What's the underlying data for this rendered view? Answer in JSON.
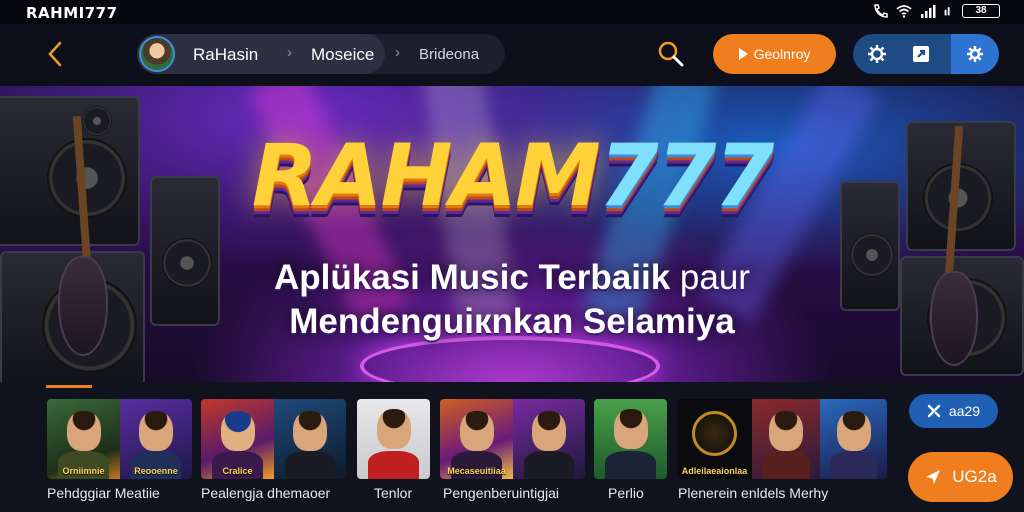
{
  "status": {
    "app_title": "RAHMI777",
    "battery": "38",
    "icons": [
      "phone-icon",
      "wifi-icon",
      "signal-icon",
      "signal-icon",
      "battery-icon"
    ]
  },
  "header": {
    "back_icon": "chevron-left-icon",
    "breadcrumbs": [
      {
        "label": "RaHasin"
      },
      {
        "label": "Moseice"
      },
      {
        "label": "Brideona"
      }
    ],
    "search_icon": "search-icon",
    "play_button_label": "Geolnroy",
    "tools": [
      "settings-icon",
      "share-icon",
      "gear-icon"
    ]
  },
  "banner": {
    "logo_text": "RAHAM",
    "logo_number": "777",
    "tagline_line1_main": "Aplükasi Music Terbaiik",
    "tagline_line1_tail": "paur",
    "tagline_line2": "Mendenguiкnkan Selamiya"
  },
  "carousel": {
    "progress": 0.05,
    "cards": [
      {
        "label": "Pehdggiar Meatiie",
        "captions": [
          "Orniimnie",
          "Reooenne"
        ]
      },
      {
        "label": "Pealengja dhemaoer",
        "captions": [
          "Cralice",
          ""
        ]
      },
      {
        "label": "Tenlor",
        "captions": [
          ""
        ]
      },
      {
        "label": "Pengenberuintigjai",
        "captions": [
          "Mecaseuitiiaa",
          ""
        ]
      },
      {
        "label": "Perlio",
        "captions": [
          ""
        ]
      },
      {
        "label": "Plenerein enldels Merhy",
        "captions": [
          "Adleilaeaionlaa",
          ""
        ]
      }
    ],
    "side_button_label": "aa29",
    "fab_label": "UG2a"
  },
  "colors": {
    "accent": "#f07d1e",
    "primary_blue": "#2f74d0",
    "background": "#0d0f1a"
  }
}
